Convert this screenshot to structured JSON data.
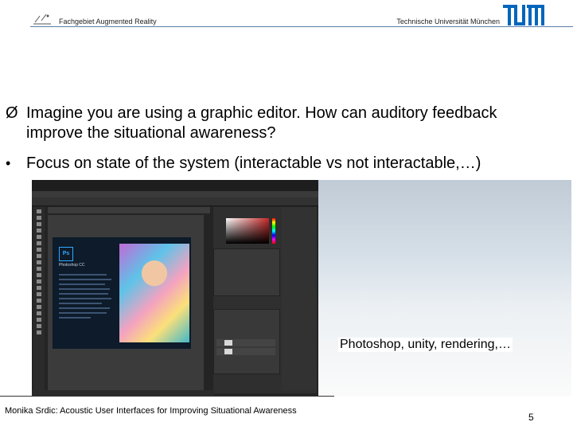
{
  "header": {
    "left": "Fachgebiet Augmented Reality",
    "right": "Technische Universität München"
  },
  "bullets": [
    {
      "marker": "Ø",
      "text": "Imagine you are using a graphic editor. How can auditory feedback improve the situational awareness?"
    },
    {
      "marker": "•",
      "text": "Focus on state of the system (interactable vs not interactable,…)"
    }
  ],
  "screenshot": {
    "app_logo": "Ps",
    "app_name": "Photoshop CC"
  },
  "caption": "Photoshop, unity, rendering,…",
  "footer": {
    "text": "Monika Srdic: Acoustic User Interfaces for Improving Situational Awareness",
    "page": "5"
  },
  "colors": {
    "header_rule": "#5a7fa8",
    "ps_blue": "#31a8ff"
  },
  "icons": [
    "augmented-reality-logo",
    "tum-logo",
    "photoshop-logo"
  ]
}
